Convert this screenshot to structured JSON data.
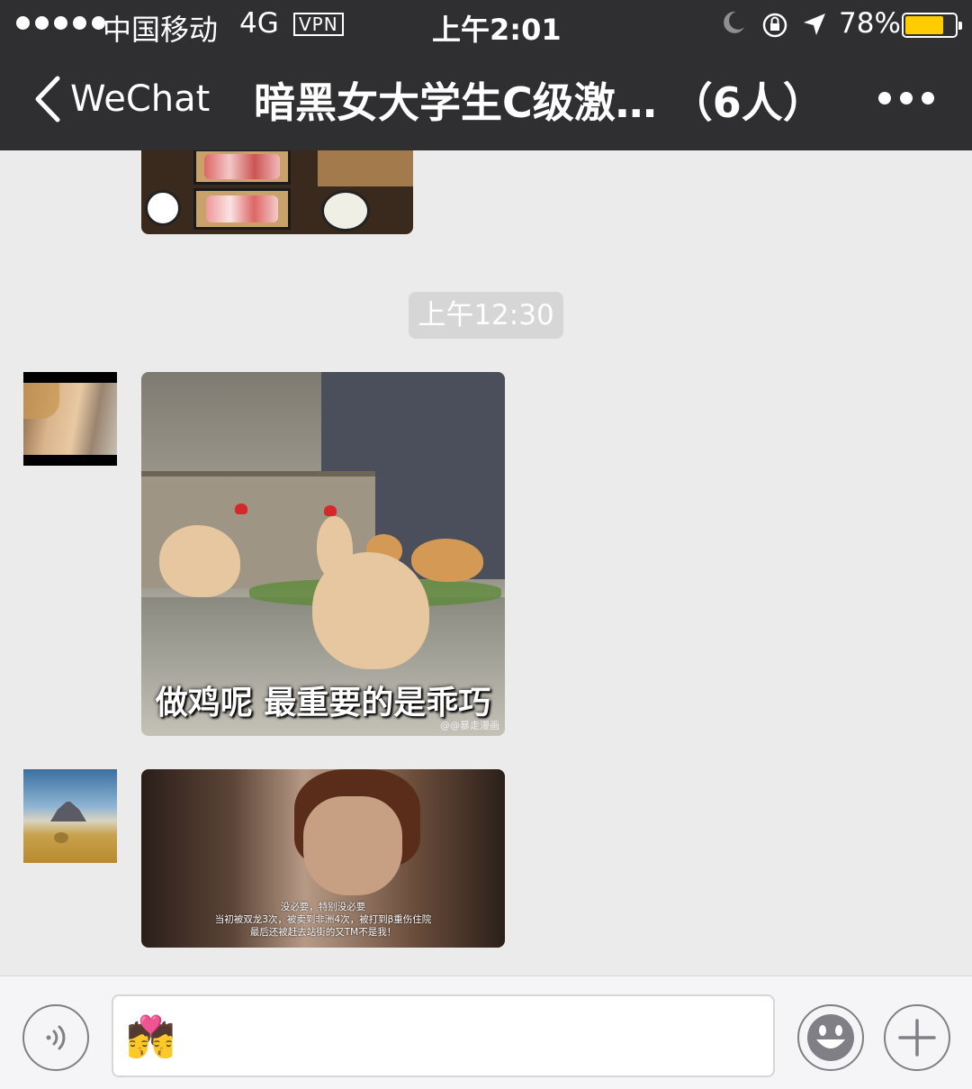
{
  "status_bar": {
    "carrier": "中国移动",
    "network": "4G",
    "vpn": "VPN",
    "time": "上午2:01",
    "battery": "78%",
    "battery_level": 0.78,
    "battery_color": "#ffcc00",
    "icons": [
      "signal-dots-icon",
      "moon-icon",
      "rotation-lock-icon",
      "location-arrow-icon",
      "battery-icon"
    ]
  },
  "nav": {
    "back_label": "WeChat",
    "title": "暗黑女大学生C级激… （6人）",
    "icons": [
      "chevron-left-icon",
      "more-dots-icon"
    ]
  },
  "chat": {
    "time_separator": "上午12:30",
    "messages": [
      {
        "type": "image",
        "subject": "hotpot-meal-photo"
      },
      {
        "type": "image",
        "subject": "chicken-meme",
        "caption": "做鸡呢 最重要的是乖巧",
        "watermark": "@@暴走漫画"
      },
      {
        "type": "image",
        "subject": "movie-still-meme",
        "subtitles": [
          "没必要，特别没必要",
          "当初被双龙3次，被卖到非洲4次，被打到β重伤住院",
          "最后还被赶去站街的又TM不是我！"
        ]
      }
    ]
  },
  "input": {
    "value": "💏",
    "icons": [
      "voice-icon",
      "emoji-face-icon",
      "plus-icon"
    ]
  },
  "colors": {
    "nav_bg": "#2f2f31",
    "chat_bg": "#ebebeb",
    "input_bg": "#f5f5f7"
  }
}
